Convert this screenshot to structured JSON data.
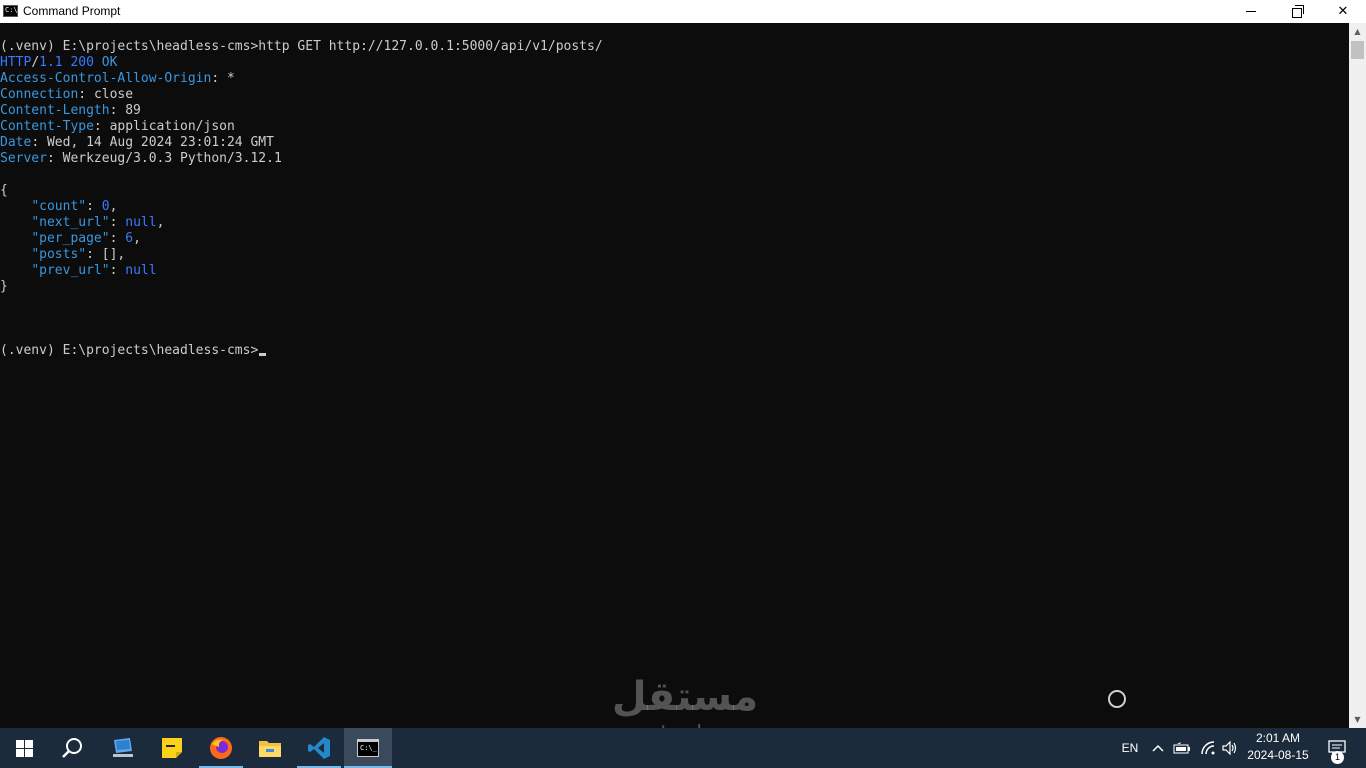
{
  "window": {
    "title": "Command Prompt",
    "icon_text": "C:\\_"
  },
  "console": {
    "prompt1": "(.venv) E:\\projects\\headless-cms>",
    "command": "http GET http://127.0.0.1:5000/api/v1/posts/",
    "status": {
      "proto": "HTTP",
      "slash": "/",
      "version": "1.1",
      "code": "200",
      "reason": "OK"
    },
    "headers": [
      {
        "name": "Access-Control-Allow-Origin",
        "value": "*"
      },
      {
        "name": "Connection",
        "value": "close"
      },
      {
        "name": "Content-Length",
        "value": "89"
      },
      {
        "name": "Content-Type",
        "value": "application/json"
      },
      {
        "name": "Date",
        "value": "Wed, 14 Aug 2024 23:01:24 GMT"
      },
      {
        "name": "Server",
        "value": "Werkzeug/3.0.3 Python/3.12.1"
      }
    ],
    "json_open": "{",
    "json_lines": [
      {
        "key": "\"count\"",
        "value": "0",
        "value_type": "number",
        "trail": ","
      },
      {
        "key": "\"next_url\"",
        "value": "null",
        "value_type": "null",
        "trail": ","
      },
      {
        "key": "\"per_page\"",
        "value": "6",
        "value_type": "number",
        "trail": ","
      },
      {
        "key": "\"posts\"",
        "value": "[]",
        "value_type": "plain",
        "trail": ","
      },
      {
        "key": "\"prev_url\"",
        "value": "null",
        "value_type": "null",
        "trail": ""
      }
    ],
    "json_close": "}",
    "prompt2": "(.venv) E:\\projects\\headless-cms>"
  },
  "watermark": {
    "arabic": "مستقل",
    "latin": "mostaql.com"
  },
  "taskbar": {
    "apps": [
      {
        "name": "start",
        "icon": "windows-logo-icon"
      },
      {
        "name": "search",
        "icon": "search-icon"
      },
      {
        "name": "this-pc",
        "icon": "computer-icon"
      },
      {
        "name": "sticky-notes",
        "icon": "sticky-note-icon"
      },
      {
        "name": "firefox",
        "icon": "firefox-icon"
      },
      {
        "name": "file-explorer",
        "icon": "folder-icon"
      },
      {
        "name": "vscode",
        "icon": "vscode-icon"
      },
      {
        "name": "command-prompt",
        "icon": "cmd-icon"
      }
    ],
    "language": "EN",
    "time": "2:01 AM",
    "date": "2024-08-15",
    "notification_count": "1"
  },
  "colors": {
    "console_bg": "#0c0c0c",
    "console_fg": "#cccccc",
    "header_blue": "#3a96dd",
    "value_blue": "#3b78ff",
    "taskbar_bg": "#1b2b3c"
  }
}
